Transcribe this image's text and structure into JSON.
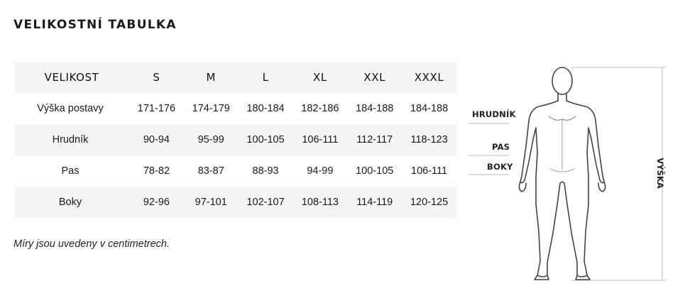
{
  "title": "VELIKOSTNÍ TABULKA",
  "table": {
    "header": [
      "VELIKOST",
      "S",
      "M",
      "L",
      "XL",
      "XXL",
      "XXXL"
    ],
    "rows": [
      {
        "label": "Výška postavy",
        "values": [
          "171-176",
          "174-179",
          "180-184",
          "182-186",
          "184-188",
          "184-188"
        ]
      },
      {
        "label": "Hrudník",
        "values": [
          "90-94",
          "95-99",
          "100-105",
          "106-111",
          "112-117",
          "118-123"
        ]
      },
      {
        "label": "Pas",
        "values": [
          "78-82",
          "83-87",
          "88-93",
          "94-99",
          "100-105",
          "106-111"
        ]
      },
      {
        "label": "Boky",
        "values": [
          "92-96",
          "97-101",
          "102-107",
          "108-113",
          "114-119",
          "120-125"
        ]
      }
    ]
  },
  "note": "Míry jsou uvedeny v centimetrech.",
  "figure": {
    "labels": {
      "chest": "HRUDNÍK",
      "waist": "PAS",
      "hips": "BOKY",
      "height": "VÝŠKA"
    },
    "icon": "body-silhouette-icon"
  }
}
